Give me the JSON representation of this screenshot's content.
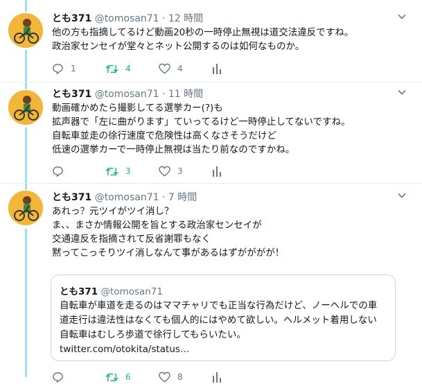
{
  "tweets": [
    {
      "name": "とも371",
      "handle": "@tomosan71",
      "dot": "·",
      "time": "12 時間",
      "lines": [
        "他の方も指摘してるけど動画20秒の一時停止無視は道交法違反ですね。",
        "政治家センセイが堂々とネット公開するのは如何なものか。"
      ],
      "reply_count": "1",
      "retweet_count": "4",
      "like_count": "4"
    },
    {
      "name": "とも371",
      "handle": "@tomosan71",
      "dot": "·",
      "time": "11 時間",
      "lines": [
        "動画確かめたら撮影してる選挙カー(?)も",
        "拡声器で「左に曲がります」ていってるけど一時停止してないですね。",
        "自転車並走の徐行速度で危険性は高くなさそうだけど",
        "低速の選挙カーで一時停止無視は当たり前なのですかね。"
      ],
      "reply_count": "",
      "retweet_count": "3",
      "like_count": "3"
    },
    {
      "name": "とも371",
      "handle": "@tomosan71",
      "dot": "·",
      "time": "7 時間",
      "lines": [
        "あれっ？元ツイがツイ消し？",
        "ま、、まさか情報公開を旨とする政治家センセイが",
        "交通違反を指摘されて反省謝罪もなく",
        "黙ってこっそりツイ消しなんて事があるはずがががが！"
      ],
      "quote": {
        "name": "とも371",
        "handle": "@tomosan71",
        "lines": [
          "自転車が車道を走るのはママチャリでも正当な行為だけど、ノーヘルでの車",
          "道走行は違法性はなくても個人的にはやめて欲しい。ヘルメット着用しない",
          "自転車はむしろ歩道で徐行してもらいたい。",
          "twitter.com/otokita/status…"
        ]
      },
      "reply_count": "",
      "retweet_count": "6",
      "like_count": "8"
    }
  ],
  "icons": {
    "reply": "reply-icon",
    "retweet": "retweet-icon",
    "like": "heart-icon",
    "analytics": "analytics-icon",
    "caret": "chevron-down-icon",
    "avatar": "cyclist-avatar"
  },
  "colors": {
    "thread_line": "#a6dbf6",
    "retweet_active": "#17bf63",
    "secondary_text": "#657786",
    "avatar_bg": "#f2b63a"
  }
}
